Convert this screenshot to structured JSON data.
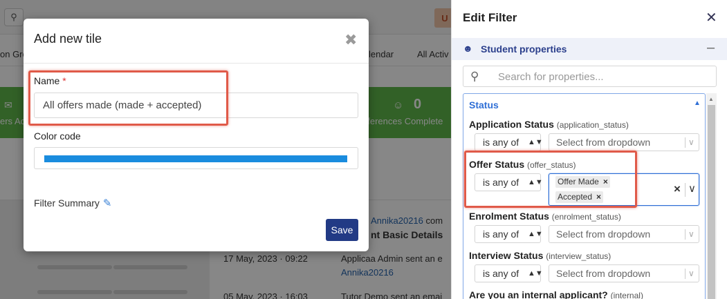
{
  "background": {
    "top_button": "U",
    "tabs": [
      "on Gro",
      "lendar",
      "All Activ"
    ],
    "green_counters": [
      {
        "label": "ers Ac",
        "value": ""
      },
      {
        "label": "eferences Complete",
        "value": "0"
      }
    ],
    "activity": [
      {
        "time": "",
        "text_prefix": "",
        "link": "Annika20216",
        "suffix": " com",
        "bold_line": "nt Basic Details"
      },
      {
        "time": "17 May, 2023 · 09:22",
        "text_prefix": "Applicaa Admin sent an e",
        "link": "Annika20216"
      },
      {
        "time": "05 May, 2023 · 16:03",
        "text_prefix": "Tutor Demo sent an emai"
      }
    ]
  },
  "modal": {
    "title": "Add new tile",
    "name_label": "Name",
    "required_mark": "*",
    "name_value": "All offers made (made + accepted)",
    "color_label": "Color code",
    "color_value": "#1a8cde",
    "filter_summary_label": "Filter Summary",
    "save_label": "Save"
  },
  "panel": {
    "title": "Edit Filter",
    "section_title": "Student properties",
    "search_placeholder": "Search for properties...",
    "group_title": "Status",
    "properties": [
      {
        "label": "Application Status",
        "key": "(application_status)",
        "operator": "is any of",
        "placeholder": "Select from dropdown"
      },
      {
        "label": "Offer Status",
        "key": "(offer_status)",
        "operator": "is any of",
        "selected": [
          "Offer Made",
          "Accepted"
        ]
      },
      {
        "label": "Enrolment Status",
        "key": "(enrolment_status)",
        "operator": "is any of",
        "placeholder": "Select from dropdown"
      },
      {
        "label": "Interview Status",
        "key": "(interview_status)",
        "operator": "is any of",
        "placeholder": "Select from dropdown"
      },
      {
        "label": "Are you an internal applicant?",
        "key": "(internal)"
      }
    ]
  },
  "colors": {
    "accent": "#2f6fd6",
    "primary_button": "#223a85",
    "highlight": "#e05a49",
    "green_bar": "#5fb84a"
  }
}
